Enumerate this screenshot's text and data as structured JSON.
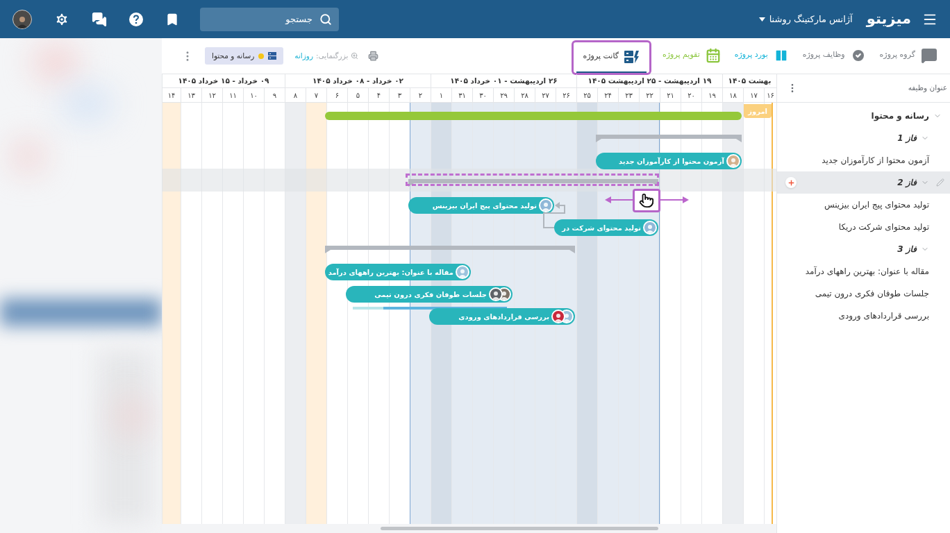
{
  "topbar": {
    "brand": "میزیتو",
    "workspace": "آژانس مارکتینگ روشنا",
    "search": {
      "placeholder": "جستجو"
    }
  },
  "views": [
    {
      "label": "گروه پروژه",
      "kind": "chat",
      "color": "#7a7f85",
      "selected": false
    },
    {
      "label": "وظایف پروژه",
      "kind": "tasks",
      "color": "#7a7f85",
      "selected": false
    },
    {
      "label": "بورد پروژه",
      "kind": "board",
      "color": "#13b3d8",
      "selected": false
    },
    {
      "label": "تقویم پروژه",
      "kind": "calendar",
      "color": "#8cc63f",
      "selected": false
    },
    {
      "label": "گانت پروژه",
      "kind": "gantt",
      "color": "#1f5b8a",
      "selected": true
    }
  ],
  "zoom": {
    "label": "بزرگنمایی:",
    "value": "روزانه"
  },
  "filter_chip": {
    "label": "رسانه و محتوا",
    "color": "#f5c518"
  },
  "task_list": {
    "header": "عنوان وظیفه"
  },
  "timeline": {
    "today_label": "امروز",
    "weeks": [
      {
        "label": "بهشت ۱۴۰۵",
        "days": [
          {
            "label": "۱۶",
            "kind": "today",
            "highlighted": false
          },
          {
            "label": "۱۷",
            "kind": "normal",
            "highlighted": false
          },
          {
            "label": "۱۸",
            "kind": "weekend",
            "highlighted": false
          }
        ]
      },
      {
        "label": "۱۹ اردیبهشت - ۲۵ اردیبهشت ۱۴۰۵",
        "days": [
          {
            "label": "۱۹",
            "kind": "normal",
            "highlighted": false
          },
          {
            "label": "۲۰",
            "kind": "normal",
            "highlighted": false
          },
          {
            "label": "۲۱",
            "kind": "normal",
            "highlighted": false
          },
          {
            "label": "۲۲",
            "kind": "normal",
            "highlighted": true
          },
          {
            "label": "۲۳",
            "kind": "normal",
            "highlighted": true
          },
          {
            "label": "۲۴",
            "kind": "normal",
            "highlighted": true
          },
          {
            "label": "۲۵",
            "kind": "weekend",
            "highlighted": true
          }
        ]
      },
      {
        "label": "۲۶ اردیبهشت - ۰۱ خرداد ۱۴۰۵",
        "days": [
          {
            "label": "۲۶",
            "kind": "normal",
            "highlighted": true
          },
          {
            "label": "۲۷",
            "kind": "normal",
            "highlighted": true
          },
          {
            "label": "۲۸",
            "kind": "normal",
            "highlighted": true
          },
          {
            "label": "۲۹",
            "kind": "normal",
            "highlighted": true
          },
          {
            "label": "۳۰",
            "kind": "normal",
            "highlighted": true
          },
          {
            "label": "۳۱",
            "kind": "normal",
            "highlighted": true
          },
          {
            "label": "۱",
            "kind": "weekend",
            "highlighted": true
          }
        ]
      },
      {
        "label": "۰۲ خرداد - ۰۸ خرداد ۱۴۰۵",
        "days": [
          {
            "label": "۲",
            "kind": "normal",
            "highlighted": true
          },
          {
            "label": "۳",
            "kind": "normal",
            "highlighted": false
          },
          {
            "label": "۴",
            "kind": "normal",
            "highlighted": false
          },
          {
            "label": "۵",
            "kind": "normal",
            "highlighted": false
          },
          {
            "label": "۶",
            "kind": "normal",
            "highlighted": false
          },
          {
            "label": "۷",
            "kind": "holiday",
            "highlighted": false
          },
          {
            "label": "۸",
            "kind": "weekend",
            "highlighted": false
          }
        ]
      },
      {
        "label": "۰۹ خرداد - ۱۵ خرداد ۱۴۰۵",
        "days": [
          {
            "label": "۹",
            "kind": "normal",
            "highlighted": false
          },
          {
            "label": "۱۰",
            "kind": "normal",
            "highlighted": false
          },
          {
            "label": "۱۱",
            "kind": "normal",
            "highlighted": false
          },
          {
            "label": "۱۲",
            "kind": "normal",
            "highlighted": false
          },
          {
            "label": "۱۳",
            "kind": "normal",
            "highlighted": false
          },
          {
            "label": "۱۴",
            "kind": "holiday",
            "highlighted": false
          }
        ]
      }
    ]
  },
  "tasks": [
    {
      "title": "رسانه و محتوا",
      "kind": "project",
      "expanded": true,
      "selected": false,
      "children": [
        {
          "title": "فاز 1",
          "kind": "phase",
          "expanded": true,
          "selected": false,
          "children": [
            {
              "title": "آزمون محتوا از کارآموزان جدید",
              "kind": "task",
              "selected": false,
              "bar_label": "آزمون محتوا از کارآموزان جدید",
              "avatars": [
                {
                  "color": "#d4b08c"
                }
              ]
            }
          ]
        },
        {
          "title": "فاز 2",
          "kind": "phase",
          "expanded": true,
          "selected": true,
          "children": [
            {
              "title": "تولید محتوای پیج ایران بیزینس",
              "kind": "task",
              "selected": false,
              "bar_label": "تولید محتوای پیج ایران بیزینس",
              "avatars": [
                {
                  "color": "#8fb8d8"
                }
              ]
            },
            {
              "title": "تولید محتوای شرکت دریکا",
              "kind": "task",
              "selected": false,
              "bar_label": "تولید محتوای شرکت در",
              "avatars": [
                {
                  "color": "#8fb8d8"
                }
              ]
            }
          ]
        },
        {
          "title": "فاز 3",
          "kind": "phase",
          "expanded": true,
          "selected": false,
          "children": [
            {
              "title": "مقاله با عنوان: بهترین راههای درآمد",
              "kind": "task",
              "selected": false,
              "bar_label": "مقاله با عنوان: بهترین راههای درآمد",
              "avatars": [
                {
                  "color": "#9cc3dd"
                }
              ]
            },
            {
              "title": "جلسات طوفان فکری درون تیمی",
              "kind": "task",
              "selected": false,
              "bar_label": "جلسات طوفان فکری درون تیمی",
              "avatars": [
                {
                  "color": "#7d7268"
                },
                {
                  "color": "#5f6368"
                }
              ],
              "progress": {
                "level": 0.8
              }
            },
            {
              "title": "بررسی قراردادهای ورودی",
              "kind": "task",
              "selected": false,
              "bar_label": "بررسی قراردادهای ورودی",
              "avatars": [
                {
                  "color": "#9cc3dd"
                },
                {
                  "color": "#c8283c"
                }
              ]
            }
          ]
        }
      ]
    }
  ]
}
